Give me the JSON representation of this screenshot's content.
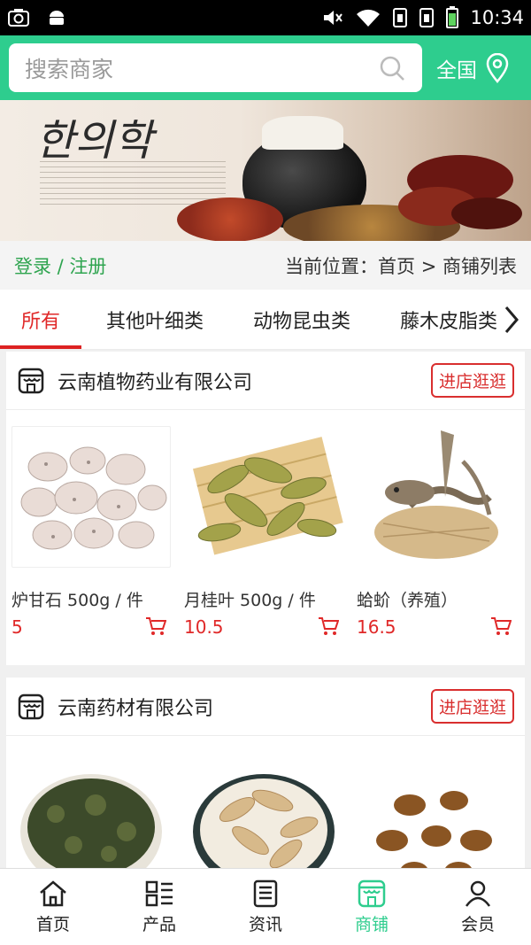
{
  "status_bar": {
    "time": "10:34"
  },
  "header": {
    "search_placeholder": "搜索商家",
    "region": "全国"
  },
  "location": {
    "login_text": "登录 / 注册",
    "position_text": "当前位置：首页 > 商铺列表"
  },
  "categories": [
    "所有",
    "其他叶细类",
    "动物昆虫类",
    "藤木皮脂类"
  ],
  "active_category": "所有",
  "shops": [
    {
      "name": "云南植物药业有限公司",
      "enter_label": "进店逛逛",
      "products": [
        {
          "name": "炉甘石 500g / 件",
          "price": "5"
        },
        {
          "name": "月桂叶 500g / 件",
          "price": "10.5"
        },
        {
          "name": "蛤蚧（养殖）",
          "price": "16.5"
        }
      ]
    },
    {
      "name": "云南药材有限公司",
      "enter_label": "进店逛逛",
      "products": []
    }
  ],
  "bottom_nav": [
    {
      "label": "首页",
      "icon": "home-icon"
    },
    {
      "label": "产品",
      "icon": "grid-list-icon"
    },
    {
      "label": "资讯",
      "icon": "news-icon"
    },
    {
      "label": "商铺",
      "icon": "store-icon",
      "active": true
    },
    {
      "label": "会员",
      "icon": "user-icon"
    }
  ],
  "colors": {
    "brand": "#2ecd8e",
    "accent_red": "#e02828",
    "login_green": "#2ea44f"
  }
}
